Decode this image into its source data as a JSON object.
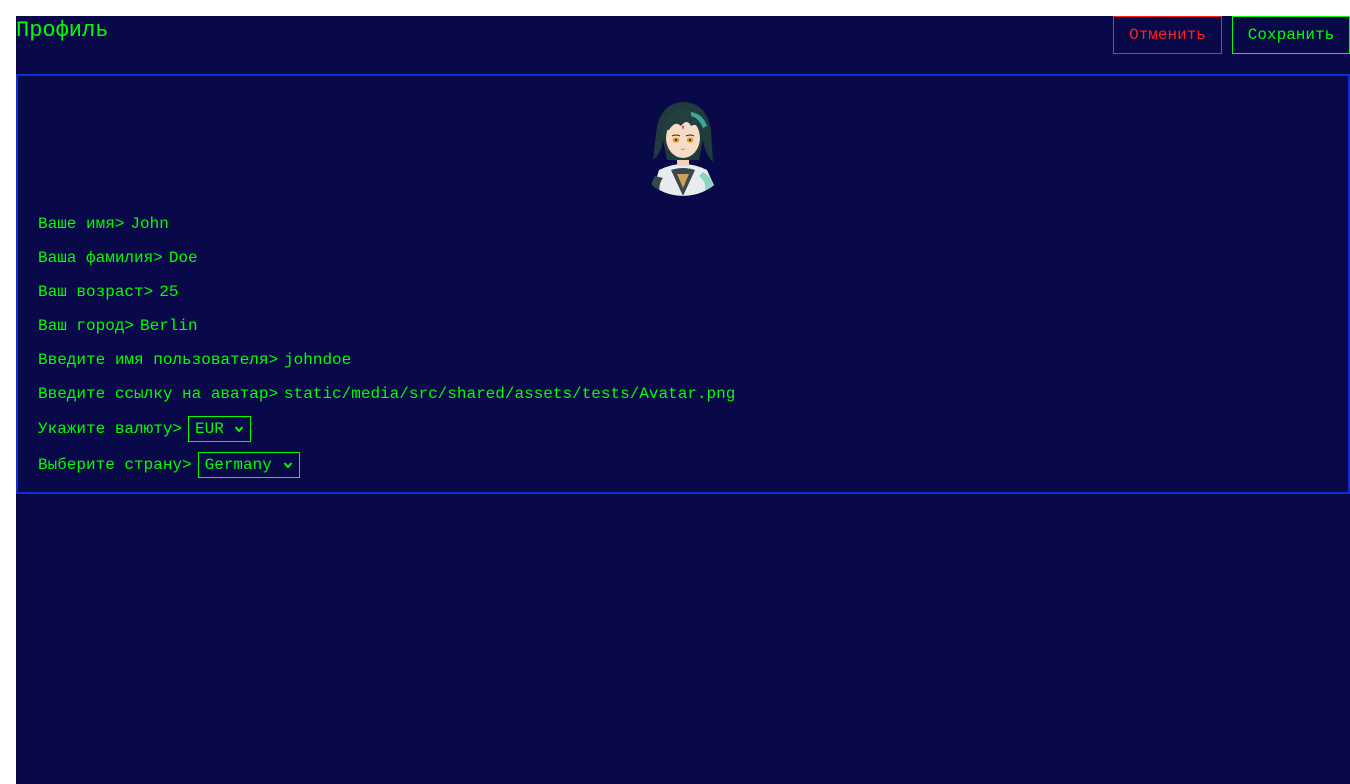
{
  "header": {
    "title": "Профиль",
    "cancel_label": "Отменить",
    "save_label": "Сохранить"
  },
  "profile": {
    "avatar_icon": "character-avatar-image",
    "fields": {
      "first_name": {
        "label": "Ваше имя>",
        "value": "John"
      },
      "last_name": {
        "label": "Ваша фамилия>",
        "value": "Doe"
      },
      "age": {
        "label": "Ваш возраст>",
        "value": "25"
      },
      "city": {
        "label": "Ваш город>",
        "value": "Berlin"
      },
      "username": {
        "label": "Введите имя пользователя>",
        "value": "johndoe"
      },
      "avatar_url": {
        "label": "Введите ссылку на аватар>",
        "value": "static/media/src/shared/assets/tests/Avatar.png"
      },
      "currency": {
        "label": "Укажите валюту>",
        "value": "EUR"
      },
      "country": {
        "label": "Выберите страну>",
        "value": "Germany"
      }
    }
  },
  "colors": {
    "background": "#090949",
    "text": "#00ff00",
    "cancel": "#ff1f1f",
    "card_border": "#0a2fd1"
  }
}
